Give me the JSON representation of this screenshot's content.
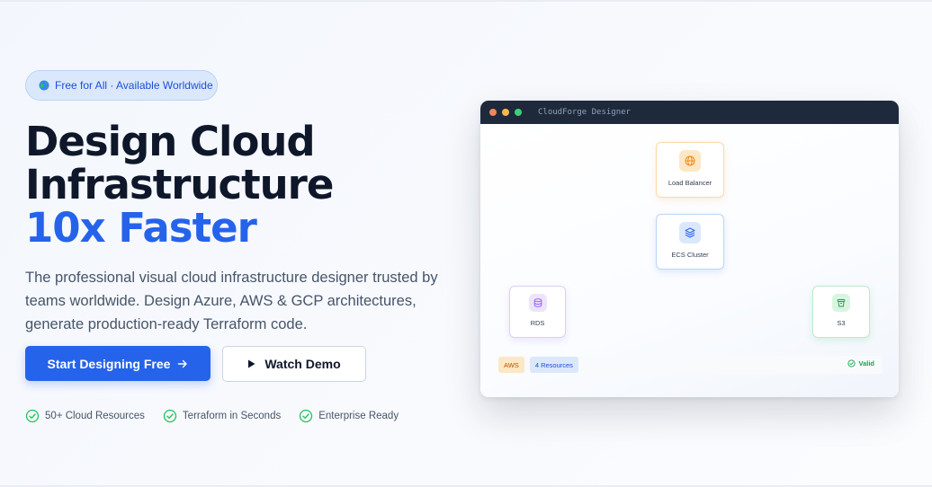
{
  "badge": {
    "icon": "globe-icon",
    "text": "Free for All · Available Worldwide"
  },
  "hero": {
    "line1": "Design Cloud",
    "line2": "Infrastructure",
    "line3": "10x Faster",
    "subtitle": "The professional visual cloud infrastructure designer trusted by teams worldwide. Design Azure, AWS & GCP architectures, generate production-ready Terraform code."
  },
  "buttons": {
    "primary_label": "Start Designing Free",
    "primary_icon": "arrow-right-icon",
    "secondary_label": "Watch Demo",
    "secondary_icon": "play-icon"
  },
  "features": [
    {
      "label": "50+ Cloud Resources",
      "icon": "check-circle-icon"
    },
    {
      "label": "Terraform in Seconds",
      "icon": "check-circle-icon"
    },
    {
      "label": "Enterprise Ready",
      "icon": "check-circle-icon"
    }
  ],
  "designer": {
    "title": "CloudForge Designer",
    "nodes": {
      "load_balancer": "Load Balancer",
      "ecs": "ECS Cluster",
      "rds": "RDS",
      "s3": "S3"
    },
    "status": {
      "provider": "AWS",
      "resources": "4 Resources",
      "valid": "Valid"
    }
  },
  "colors": {
    "accent": "#2563eb",
    "dark": "#0f172a",
    "success": "#22c55e",
    "titlebar": "#1e293b",
    "dot_red": "#f0875a",
    "dot_yellow": "#f5b94b",
    "dot_green": "#3fcf7a"
  }
}
